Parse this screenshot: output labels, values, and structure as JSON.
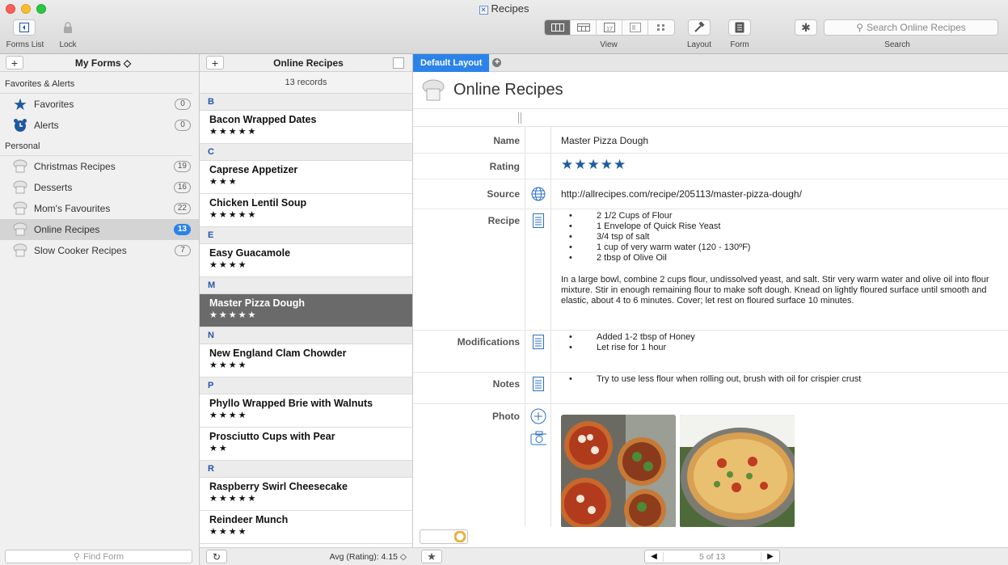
{
  "window": {
    "title": "Recipes"
  },
  "toolbar": {
    "forms_list_label": "Forms List",
    "lock_label": "Lock",
    "view_label": "View",
    "layout_label": "Layout",
    "form_label": "Form",
    "search_label": "Search",
    "search_placeholder": "Search Online Recipes"
  },
  "sidebar": {
    "title": "My Forms ◇",
    "section_favorites": "Favorites & Alerts",
    "section_personal": "Personal",
    "favorites": [
      {
        "label": "Favorites",
        "count": "0",
        "icon": "star-icon"
      },
      {
        "label": "Alerts",
        "count": "0",
        "icon": "alarm-clock-icon"
      }
    ],
    "forms": [
      {
        "label": "Christmas Recipes",
        "count": "19"
      },
      {
        "label": "Desserts",
        "count": "16"
      },
      {
        "label": "Mom's Favourites",
        "count": "22"
      },
      {
        "label": "Online Recipes",
        "count": "13"
      },
      {
        "label": "Slow Cooker Recipes",
        "count": "7"
      }
    ],
    "find_placeholder": "Find Form"
  },
  "list": {
    "title": "Online Recipes",
    "record_count": "13 records",
    "groups": [
      {
        "letter": "B",
        "records": [
          {
            "name": "Bacon Wrapped Dates",
            "stars": "★★★★★"
          }
        ]
      },
      {
        "letter": "C",
        "records": [
          {
            "name": "Caprese Appetizer",
            "stars": "★★★"
          },
          {
            "name": "Chicken Lentil Soup",
            "stars": "★★★★★"
          }
        ]
      },
      {
        "letter": "E",
        "records": [
          {
            "name": "Easy Guacamole",
            "stars": "★★★★"
          }
        ]
      },
      {
        "letter": "M",
        "records": [
          {
            "name": "Master Pizza Dough",
            "stars": "★★★★★"
          }
        ]
      },
      {
        "letter": "N",
        "records": [
          {
            "name": "New England Clam Chowder",
            "stars": "★★★★"
          }
        ]
      },
      {
        "letter": "P",
        "records": [
          {
            "name": "Phyllo Wrapped Brie with Walnuts",
            "stars": "★★★★"
          },
          {
            "name": "Prosciutto Cups with Pear",
            "stars": "★★"
          }
        ]
      },
      {
        "letter": "R",
        "records": [
          {
            "name": "Raspberry Swirl Cheesecake",
            "stars": "★★★★★"
          },
          {
            "name": "Reindeer Munch",
            "stars": "★★★★"
          }
        ]
      }
    ],
    "avg_label": "Avg (Rating): 4.15 ◇"
  },
  "detail": {
    "tab_label": "Default Layout",
    "form_title": "Online Recipes",
    "labels": {
      "name": "Name",
      "rating": "Rating",
      "source": "Source",
      "recipe": "Recipe",
      "modifications": "Modifications",
      "notes": "Notes",
      "photo": "Photo"
    },
    "name_value": "Master Pizza Dough",
    "rating_value": "★★★★★",
    "source_value": "http://allrecipes.com/recipe/205113/master-pizza-dough/",
    "recipe_items": [
      "2 1/2 Cups of Flour",
      "1 Envelope of Quick Rise Yeast",
      "3/4 tsp of salt",
      "1 cup of very warm water (120 - 130ºF)",
      "2 tbsp of Olive Oil"
    ],
    "recipe_text": "In a large bowl, combine 2 cups flour, undissolved yeast, and salt. Stir very warm water and olive oil into flour mixture. Stir in enough remaining flour to make soft dough. Knead on lightly floured surface until smooth and elastic, about 4 to 6 minutes. Cover; let rest on floured surface 10 minutes.",
    "modifications_items": [
      "Added 1-2 tbsp of Honey",
      "Let rise for 1 hour"
    ],
    "notes_items": [
      "Try to use less flour when rolling out, brush with oil for crispier crust"
    ],
    "pager": "5 of 13"
  },
  "colors": {
    "accent": "#2b83e8",
    "selected_row": "#6a6a6a",
    "star_blue": "#1f5aa0"
  }
}
